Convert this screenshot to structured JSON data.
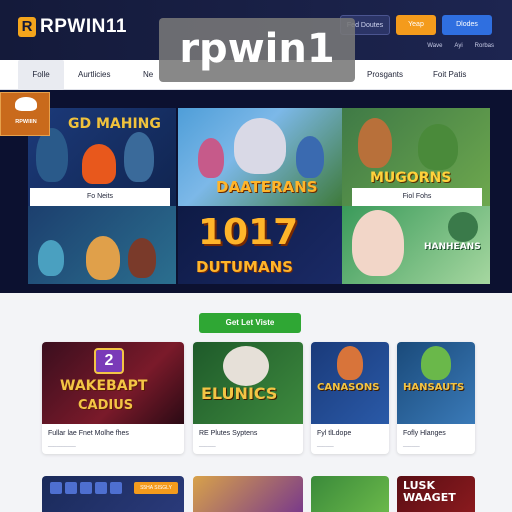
{
  "header": {
    "logo_mark": "R",
    "logo_text": "RPWIN11",
    "buttons": [
      "Fed Doutes",
      "Yeap",
      "Dlodes"
    ],
    "links": [
      "Wave",
      "Ayi",
      "Rorbas"
    ]
  },
  "nav": {
    "items": [
      "Folle",
      "Aurtlicies",
      "Ne",
      "Prosgants",
      "Foit Patis"
    ]
  },
  "watermark": "rpwin1",
  "hero": {
    "corner_badge": "RPWIIIN",
    "tiles": [
      {
        "title": "GD MAHING",
        "label": "Fo Neits"
      },
      {
        "title": "DAATERANS",
        "label": ""
      },
      {
        "title": "MUGORNS",
        "label": "Fiol Fohs"
      },
      {
        "title": "",
        "label": ""
      },
      {
        "title": "1017",
        "subtitle": "DUTUMANS",
        "label": ""
      },
      {
        "title": "HANHEANS",
        "label": ""
      }
    ]
  },
  "cta": "Get Let Viste",
  "cards": [
    {
      "badge": "2",
      "title": "WAKEBAPT",
      "title2": "CADIUS",
      "caption": "Fullar lae Fnet Molhe fhes",
      "sub": "__________"
    },
    {
      "title": "ELUNICS",
      "caption": "RE Plutes Syptens",
      "sub": "______"
    },
    {
      "title": "CANASONS",
      "caption": "Fyl tlLdope",
      "sub": "______"
    },
    {
      "title": "HANSAUTS",
      "caption": "Fofly Hlanges",
      "sub": "______"
    }
  ],
  "bottom_cards": [
    {
      "button": "S5HA SISGLY",
      "title": ""
    },
    {
      "title": ""
    },
    {
      "title": ""
    },
    {
      "title": "LUSK WAAGET"
    }
  ],
  "colors": {
    "header_bg": "#141a3a",
    "accent_orange": "#f49b1c",
    "accent_blue": "#2f6fe0",
    "cta_green": "#2fa734",
    "gold_title": "#f3c545"
  }
}
